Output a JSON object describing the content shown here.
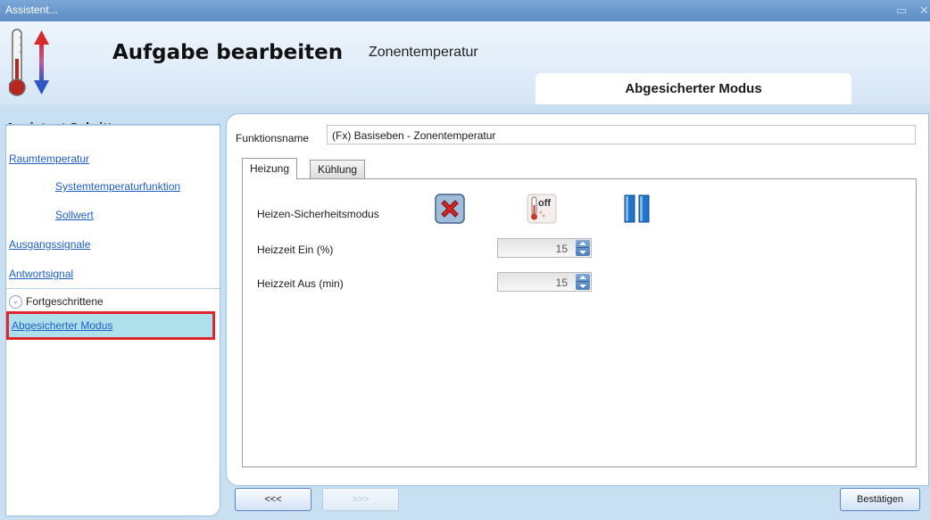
{
  "window": {
    "title": "Assistent...",
    "controls": [
      "restore-icon",
      "close-icon"
    ]
  },
  "header": {
    "icon": "thermometer-icon",
    "title": "Aufgabe bearbeiten",
    "subtitle": "Zonentemperatur",
    "section_tab": "Abgesicherter Modus"
  },
  "sidebar": {
    "title": "Assistent Schritte",
    "items": [
      {
        "label": "Raumtemperatur"
      },
      {
        "label": "Systemtemperaturfunktion"
      },
      {
        "label": "Sollwert"
      },
      {
        "label": "Ausgangssignale"
      },
      {
        "label": "Antwortsignal"
      }
    ],
    "advanced_label": "Fortgeschrittene",
    "advanced_icon": "chevron-down-icon",
    "selected_item": "Abgesicherter Modus",
    "selected_color": "#e0252b"
  },
  "form": {
    "function_name_label": "Funktionsname",
    "function_name_value": "(Fx) Basiseben - Zonentemperatur",
    "tabs": [
      {
        "label": "Heizung",
        "active": true
      },
      {
        "label": "Kühlung",
        "active": false
      }
    ],
    "safety_mode_label": "Heizen-Sicherheitsmodus",
    "safety_mode_options": [
      {
        "icon": "red-x-icon"
      },
      {
        "icon": "thermometer-off-icon",
        "text": "off"
      },
      {
        "icon": "blue-bars-icon"
      }
    ],
    "heat_on_label": "Heizzeit Ein (%)",
    "heat_on_value": "15",
    "heat_off_label": "Heizzeit Aus (min)",
    "heat_off_value": "15"
  },
  "footer": {
    "back_label": "<<<",
    "next_label": ">>>",
    "confirm_label": "Bestätigen"
  }
}
